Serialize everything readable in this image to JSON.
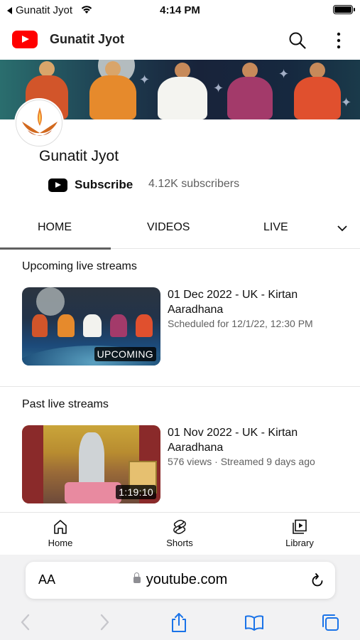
{
  "status_bar": {
    "back_app": "Gunatit Jyot",
    "time": "4:14 PM"
  },
  "app_bar": {
    "title": "Gunatit Jyot"
  },
  "channel": {
    "name": "Gunatit Jyot",
    "subscribe_label": "Subscribe",
    "subscribers": "4.12K subscribers"
  },
  "tabs": [
    {
      "label": "HOME",
      "active": true
    },
    {
      "label": "VIDEOS"
    },
    {
      "label": "LIVE"
    }
  ],
  "sections": {
    "upcoming": {
      "title": "Upcoming live streams",
      "video": {
        "title": "01 Dec 2022 - UK - Kirtan Aaradhana",
        "meta": "Scheduled for 12/1/22, 12:30 PM",
        "badge": "UPCOMING"
      }
    },
    "past": {
      "title": "Past live streams",
      "video": {
        "title": "01 Nov 2022 - UK - Kirtan Aaradhana",
        "meta": "576 views · Streamed 9 days ago",
        "badge": "1:19:10"
      }
    }
  },
  "bottom_nav": [
    {
      "label": "Home",
      "icon": "home-icon"
    },
    {
      "label": "Shorts",
      "icon": "shorts-icon"
    },
    {
      "label": "Library",
      "icon": "library-icon"
    }
  ],
  "browser": {
    "text_size_label": "AA",
    "url": "youtube.com"
  },
  "colors": {
    "brand_red": "#ff0000",
    "text_primary": "#0f0f0f",
    "text_secondary": "#606060",
    "safari_blue": "#1a73e8"
  }
}
